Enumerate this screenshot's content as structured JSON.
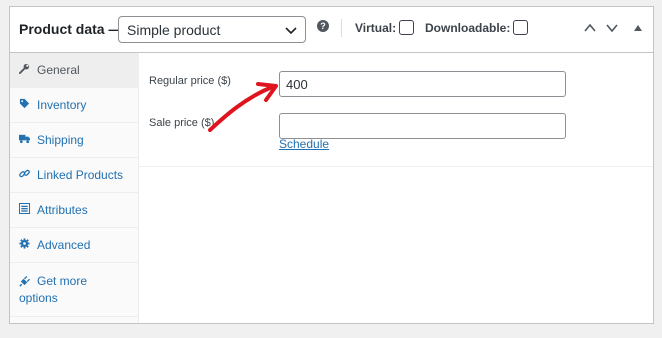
{
  "header": {
    "title": "Product data —",
    "product_type": "Simple product",
    "help_icon": "?",
    "virtual_label": "Virtual:",
    "virtual_checked": false,
    "downloadable_label": "Downloadable:",
    "downloadable_checked": false
  },
  "tabs": [
    {
      "label": "General",
      "icon": "wrench-icon",
      "active": true
    },
    {
      "label": "Inventory",
      "icon": "tag-icon",
      "active": false
    },
    {
      "label": "Shipping",
      "icon": "truck-icon",
      "active": false
    },
    {
      "label": "Linked Products",
      "icon": "link-icon",
      "active": false
    },
    {
      "label": "Attributes",
      "icon": "list-icon",
      "active": false
    },
    {
      "label": "Advanced",
      "icon": "gear-icon",
      "active": false
    },
    {
      "label": "Get more options",
      "icon": "plugin-icon",
      "active": false
    }
  ],
  "general": {
    "regular_price_label": "Regular price ($)",
    "regular_price_value": "400",
    "sale_price_label": "Sale price ($)",
    "sale_price_value": "",
    "schedule_link": "Schedule"
  },
  "colors": {
    "link": "#2271b1",
    "annotation_arrow": "#e0141e"
  }
}
